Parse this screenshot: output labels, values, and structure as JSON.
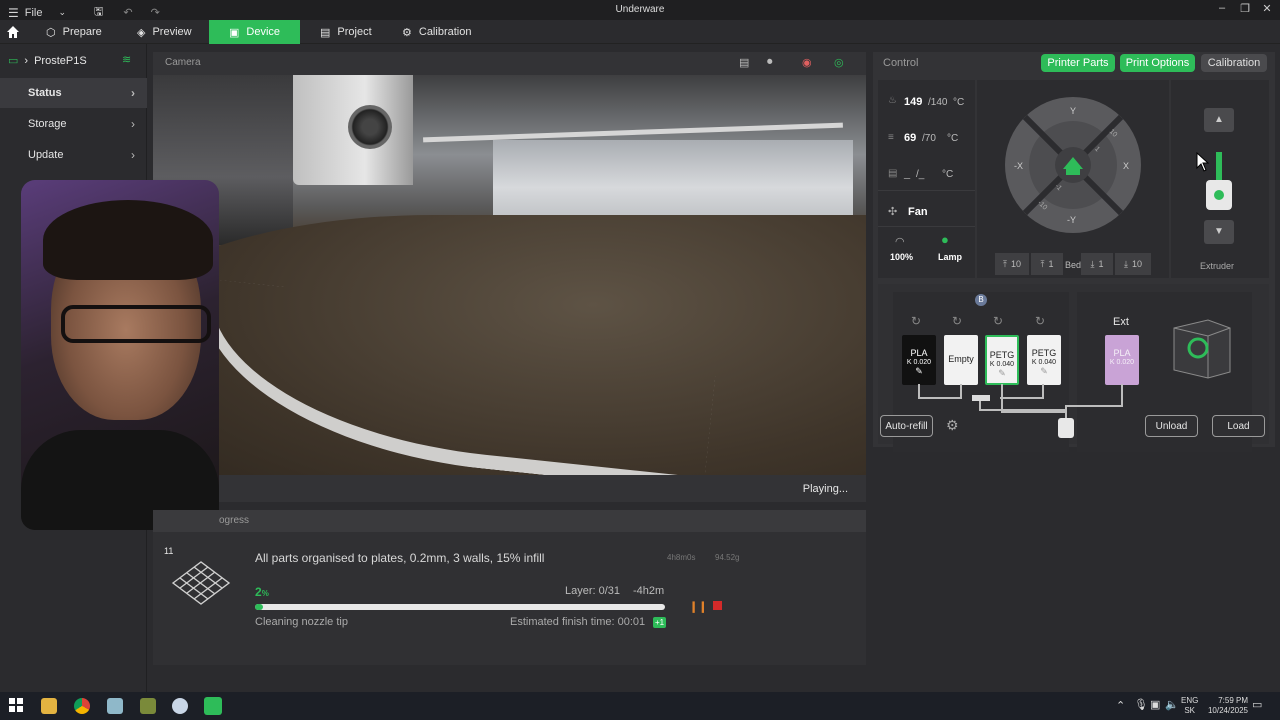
{
  "titlebar": {
    "file_menu": "File",
    "app_title": "Underware"
  },
  "nav": {
    "tabs": [
      {
        "label": "Prepare"
      },
      {
        "label": "Preview"
      },
      {
        "label": "Device"
      },
      {
        "label": "Project"
      },
      {
        "label": "Calibration"
      }
    ]
  },
  "sidebar": {
    "printer_name": "ProsteP1S",
    "items": [
      {
        "label": "Status"
      },
      {
        "label": "Storage"
      },
      {
        "label": "Update"
      }
    ]
  },
  "camera": {
    "title": "Camera",
    "status": "Playing..."
  },
  "progress": {
    "title": "Printing Progress",
    "title_visible": "ogress",
    "plate_number": "11",
    "job_name": "All parts organised to plates, 0.2mm, 3 walls, 15% infill",
    "job_time": "4h8m0s",
    "job_weight": "94.52g",
    "percent": "2",
    "percent_unit": "%",
    "progress_fraction": 0.02,
    "layer": "Layer: 0/31",
    "remaining": "-4h2m",
    "stage": "Cleaning nozzle tip",
    "finish_time": "Estimated finish time: 00:01",
    "day_offset": "+1"
  },
  "control": {
    "title": "Control",
    "buttons": {
      "printer_parts": "Printer Parts",
      "print_options": "Print Options",
      "calibration": "Calibration"
    },
    "nozzle_temp": {
      "current": "149",
      "target": "/140",
      "unit": "°C"
    },
    "bed_temp": {
      "current": "69",
      "target": "/70",
      "unit": "°C"
    },
    "chamber_temp": {
      "current": "_",
      "target": "/_",
      "unit": "°C"
    },
    "fan_label": "Fan",
    "speed": "100%",
    "lamp_label": "Lamp",
    "jog": {
      "y_plus": "Y",
      "y_minus": "-Y",
      "x_plus": "X",
      "x_minus": "-X",
      "step_10": "10",
      "step_1": "1",
      "step_neg1": "-1",
      "step_neg10": "-10"
    },
    "bed_buttons": [
      "10",
      "1",
      "Bed",
      "1",
      "10"
    ],
    "extruder_label": "Extruder"
  },
  "ams": {
    "unit_badge": "B",
    "slots": [
      {
        "type": "PLA",
        "k": "K 0.020",
        "color": "#111111"
      },
      {
        "type": "Empty",
        "k": "",
        "color": "#f2f2f2"
      },
      {
        "type": "PETG",
        "k": "K 0.040",
        "color": "#f2f2f2"
      },
      {
        "type": "PETG",
        "k": "K 0.040",
        "color": "#f2f2f2"
      }
    ],
    "ext_label": "Ext",
    "ext_slot": {
      "type": "PLA",
      "k": "K 0.020",
      "color": "#c9a3d6"
    },
    "auto_refill": "Auto-refill",
    "unload": "Unload",
    "load": "Load"
  },
  "taskbar": {
    "lang": "ENG",
    "region": "SK",
    "time": "7:59 PM",
    "date": "10/24/2025"
  },
  "colors": {
    "accent": "#2ebc59",
    "panel": "#333336",
    "background": "#2b2b2e"
  }
}
